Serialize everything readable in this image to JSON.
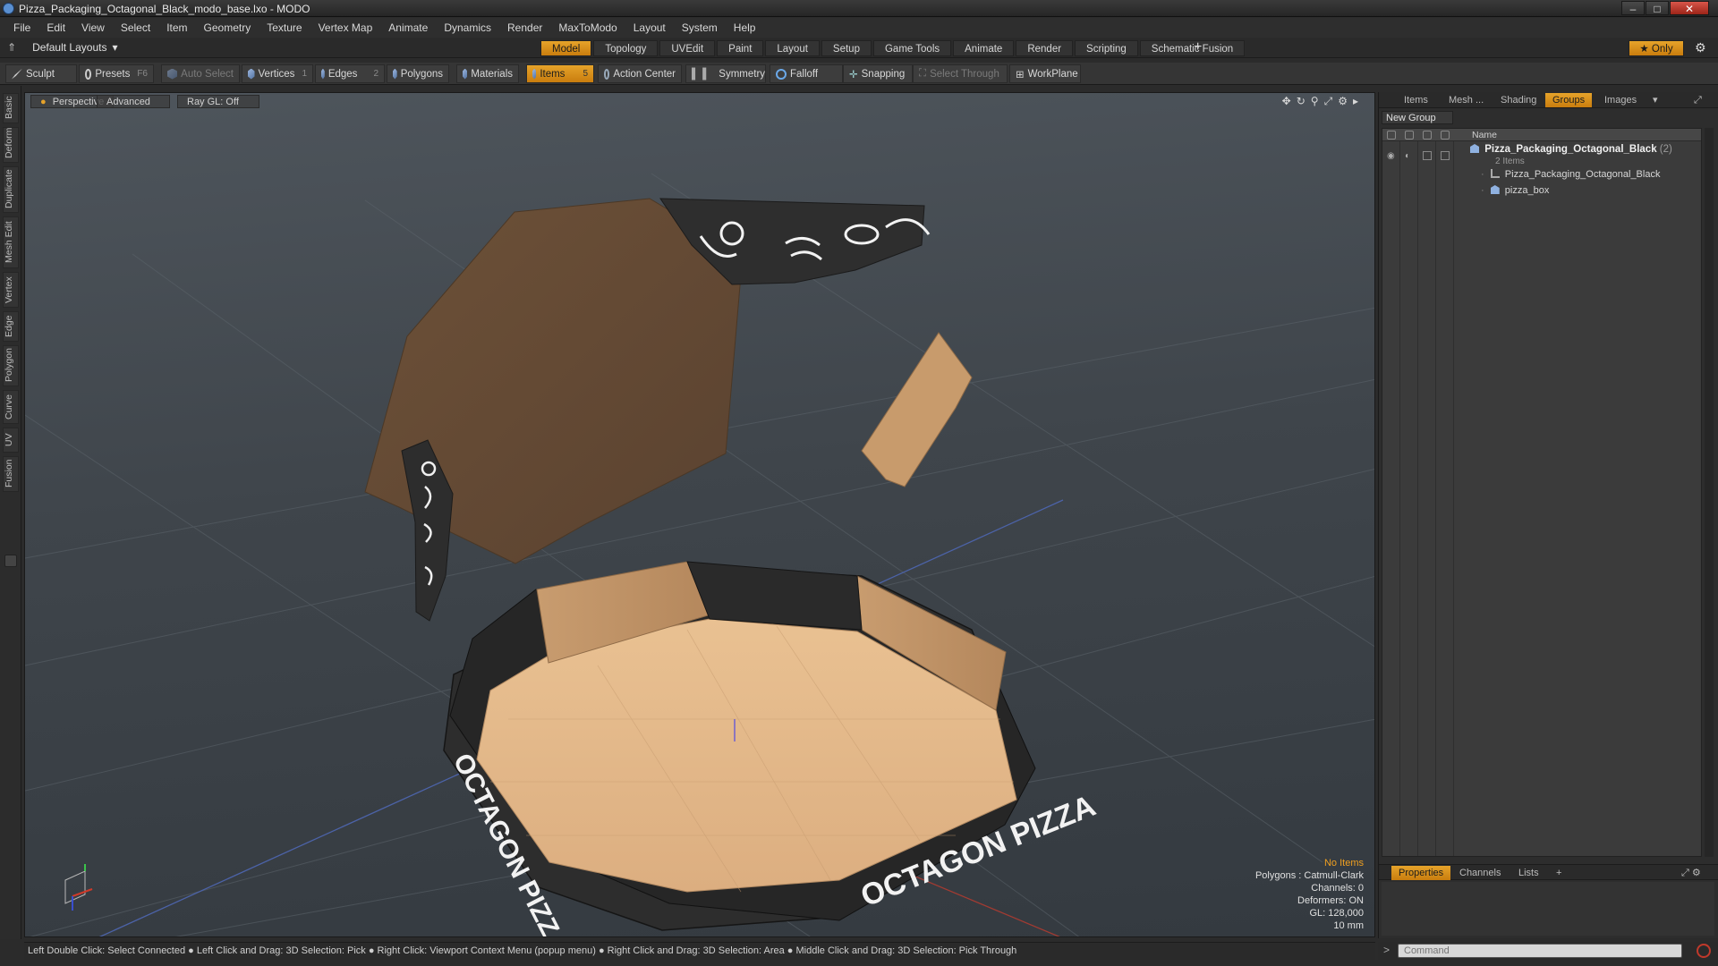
{
  "window": {
    "title": "Pizza_Packaging_Octagonal_Black_modo_base.lxo - MODO"
  },
  "menu": [
    "File",
    "Edit",
    "View",
    "Select",
    "Item",
    "Geometry",
    "Texture",
    "Vertex Map",
    "Animate",
    "Dynamics",
    "Render",
    "MaxToModo",
    "Layout",
    "System",
    "Help"
  ],
  "layout": {
    "label": "Default Layouts",
    "tabs": [
      "Model",
      "Topology",
      "UVEdit",
      "Paint",
      "Layout",
      "Setup",
      "Game Tools",
      "Animate",
      "Render",
      "Scripting",
      "Schematic Fusion"
    ],
    "active_tab": "Model",
    "only_label": "Only"
  },
  "toolbar": {
    "sculpt": "Sculpt",
    "presets": "Presets",
    "presets_key": "F6",
    "auto_select": "Auto Select",
    "vertices": "Vertices",
    "vertices_count": "1",
    "edges": "Edges",
    "edges_count": "2",
    "polygons": "Polygons",
    "materials": "Materials",
    "items": "Items",
    "items_count": "5",
    "action_center": "Action Center",
    "symmetry": "Symmetry",
    "falloff": "Falloff",
    "snapping": "Snapping",
    "select_through": "Select Through",
    "workplane": "WorkPlane"
  },
  "left_tabs": [
    "Basic",
    "Deform",
    "Duplicate",
    "Mesh Edit",
    "Vertex",
    "Edge",
    "Polygon",
    "Curve",
    "UV",
    "Fusion"
  ],
  "viewport": {
    "view": "Perspective",
    "mode": "Advanced",
    "raygl": "Ray GL: Off",
    "box_text_front": "OCTAGON PIZZA",
    "box_text_side": "OCTAGON PIZZA",
    "info": {
      "no_items": "No Items",
      "polygons": "Polygons : Catmull-Clark",
      "channels": "Channels: 0",
      "deformers": "Deformers: ON",
      "gl": "GL: 128,000",
      "scale": "10 mm"
    }
  },
  "right_panel": {
    "tabs": [
      "Items",
      "Mesh ...",
      "Shading",
      "Groups",
      "Images"
    ],
    "active_tab": "Groups",
    "new_group": "New Group",
    "column_name": "Name",
    "group": {
      "name": "Pizza_Packaging_Octagonal_Black",
      "count": "(2)",
      "sub": "2 Items",
      "children": [
        "Pizza_Packaging_Octagonal_Black",
        "pizza_box"
      ]
    },
    "bottom_tabs": [
      "Properties",
      "Channels",
      "Lists"
    ],
    "bottom_active": "Properties"
  },
  "status": {
    "hint": "Left Double Click: Select Connected ● Left Click and Drag: 3D Selection: Pick ● Right Click: Viewport Context Menu (popup menu) ● Right Click and Drag: 3D Selection: Area ● Middle Click and Drag: 3D Selection: Pick Through"
  },
  "command": {
    "placeholder": "Command"
  },
  "colors": {
    "accent": "#e6a32a",
    "box_dark": "#2c2c2c",
    "box_inner": "#e2b889",
    "box_lid": "#6a5038"
  }
}
